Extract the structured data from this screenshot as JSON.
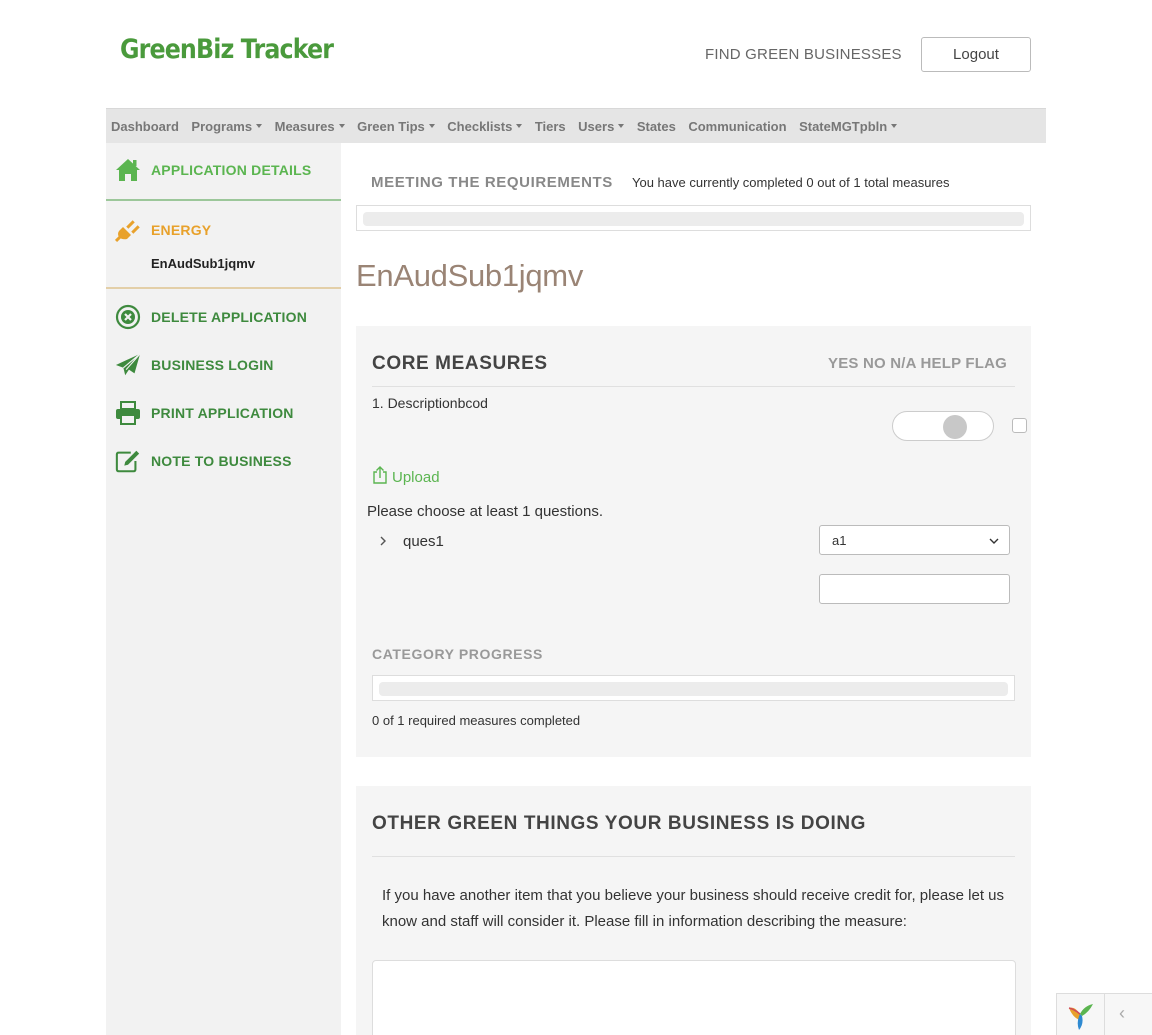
{
  "header": {
    "logo": "GreenBiz Tracker",
    "find_link": "FIND GREEN BUSINESSES",
    "logout_label": "Logout"
  },
  "nav": {
    "items": [
      {
        "label": "Dashboard",
        "dropdown": false
      },
      {
        "label": "Programs",
        "dropdown": true
      },
      {
        "label": "Measures",
        "dropdown": true
      },
      {
        "label": "Green Tips",
        "dropdown": true
      },
      {
        "label": "Checklists",
        "dropdown": true
      },
      {
        "label": "Tiers",
        "dropdown": false
      },
      {
        "label": "Users",
        "dropdown": true
      },
      {
        "label": "States",
        "dropdown": false
      },
      {
        "label": "Communication",
        "dropdown": false
      },
      {
        "label": "StateMGTpbln",
        "dropdown": true
      }
    ]
  },
  "sidebar": {
    "application_details": "APPLICATION DETAILS",
    "category": "ENERGY",
    "category_sub": "EnAudSub1jqmv",
    "delete": "DELETE APPLICATION",
    "business_login": "BUSINESS LOGIN",
    "print": "PRINT APPLICATION",
    "note": "NOTE TO BUSINESS",
    "icons": {
      "home": "home-icon",
      "energy": "plug-icon",
      "delete": "close-circle-icon",
      "login": "paper-plane-icon",
      "print": "printer-icon",
      "note": "edit-icon"
    }
  },
  "requirements": {
    "title": "MEETING THE REQUIREMENTS",
    "text": "You have currently completed 0 out of 1 total measures",
    "progress": 0
  },
  "measure_heading": "EnAudSub1jqmv",
  "core": {
    "title": "CORE MEASURES",
    "column_heads": "YES NO N/A HELP FLAG",
    "measure_label": "1. Descriptionbcod",
    "toggle_state": "unset",
    "flag_checked": false,
    "upload_label": "Upload",
    "choose_text": "Please choose at least 1 questions.",
    "question_label": "ques1",
    "select_value": "a1",
    "text_value": "",
    "category_progress_title": "CATEGORY PROGRESS",
    "category_progress": 0,
    "category_text": "0 of 1 required measures completed"
  },
  "other": {
    "title": "OTHER GREEN THINGS YOUR BUSINESS IS DOING",
    "text": "If you have another item that you believe your business should receive credit for, please let us know and staff will consider it. Please fill in information describing the measure:",
    "textarea_value": ""
  },
  "colors": {
    "brand_green": "#4a9a3c",
    "accent_green": "#5bb550",
    "energy_orange": "#e8a12b",
    "heading_brown": "#9a8475"
  },
  "debug_toolbar": {
    "toggle_glyph": "‹"
  }
}
